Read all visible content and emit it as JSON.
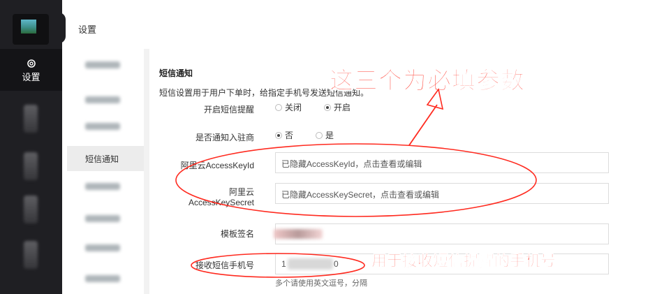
{
  "header": {
    "title": "设置"
  },
  "sidebar": {
    "active_label": "设置"
  },
  "subnav": {
    "active_label": "短信通知"
  },
  "section": {
    "title": "短信通知",
    "description": "短信设置用于用户下单时，给指定手机号发送短信通知。"
  },
  "form": {
    "sms_enable": {
      "label": "开启短信提醒",
      "opt_off": "关闭",
      "opt_on": "开启",
      "selected": "开启"
    },
    "notify_merchant": {
      "label": "是否通知入驻商",
      "opt_no": "否",
      "opt_yes": "是",
      "selected": "否"
    },
    "access_key_id": {
      "label": "阿里云AccessKeyId",
      "value": "已隐藏AccessKeyId，点击查看或编辑"
    },
    "access_key_secret": {
      "label_line1": "阿里云",
      "label_line2": "AccessKeySecret",
      "value": "已隐藏AccessKeySecret，点击查看或编辑"
    },
    "template_sign": {
      "label": "模板签名"
    },
    "receive_phone": {
      "label": "接收短信手机号",
      "value_start": "1",
      "value_end": "0",
      "hint": "多个请使用英文逗号，分隔"
    }
  },
  "annotations": {
    "required_params": "这三个为必填参数",
    "receive_phone_note": "用于接收短信提醒的手机号",
    "color": "#ff3b2f"
  }
}
